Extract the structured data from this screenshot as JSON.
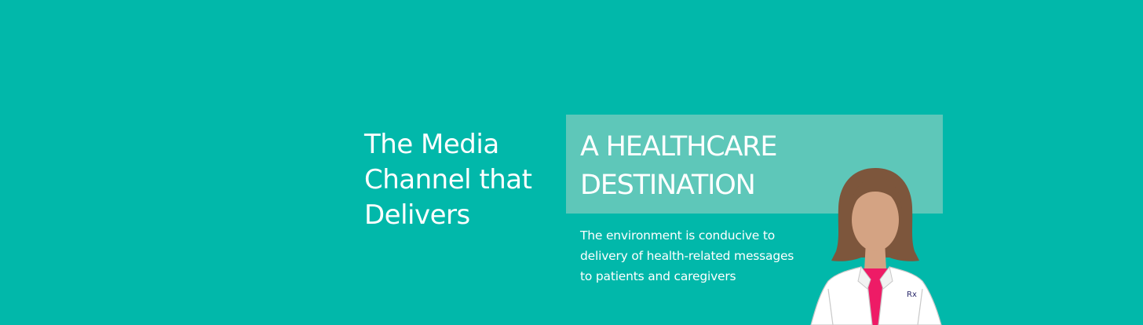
{
  "banner": {
    "heading_lines": [
      "The Media",
      "Channel that",
      "Delivers"
    ],
    "subhead_lines": [
      "A HEALTHCARE",
      "DESTINATION"
    ],
    "description_lines": [
      "The environment is conducive to",
      "delivery of health-related messages",
      "to patients and caregivers"
    ],
    "badge_text": "Rx"
  },
  "colors": {
    "background": "#01b8aa",
    "highlight_box": "#5ec7b9",
    "text": "#ffffff",
    "hair": "#7d563c",
    "skin": "#d4a383",
    "shirt": "#ee1b66",
    "coat": "#ffffff",
    "badge_text": "#2b2a6b"
  },
  "icons": {
    "illustration": "female-pharmacist-illustration"
  }
}
